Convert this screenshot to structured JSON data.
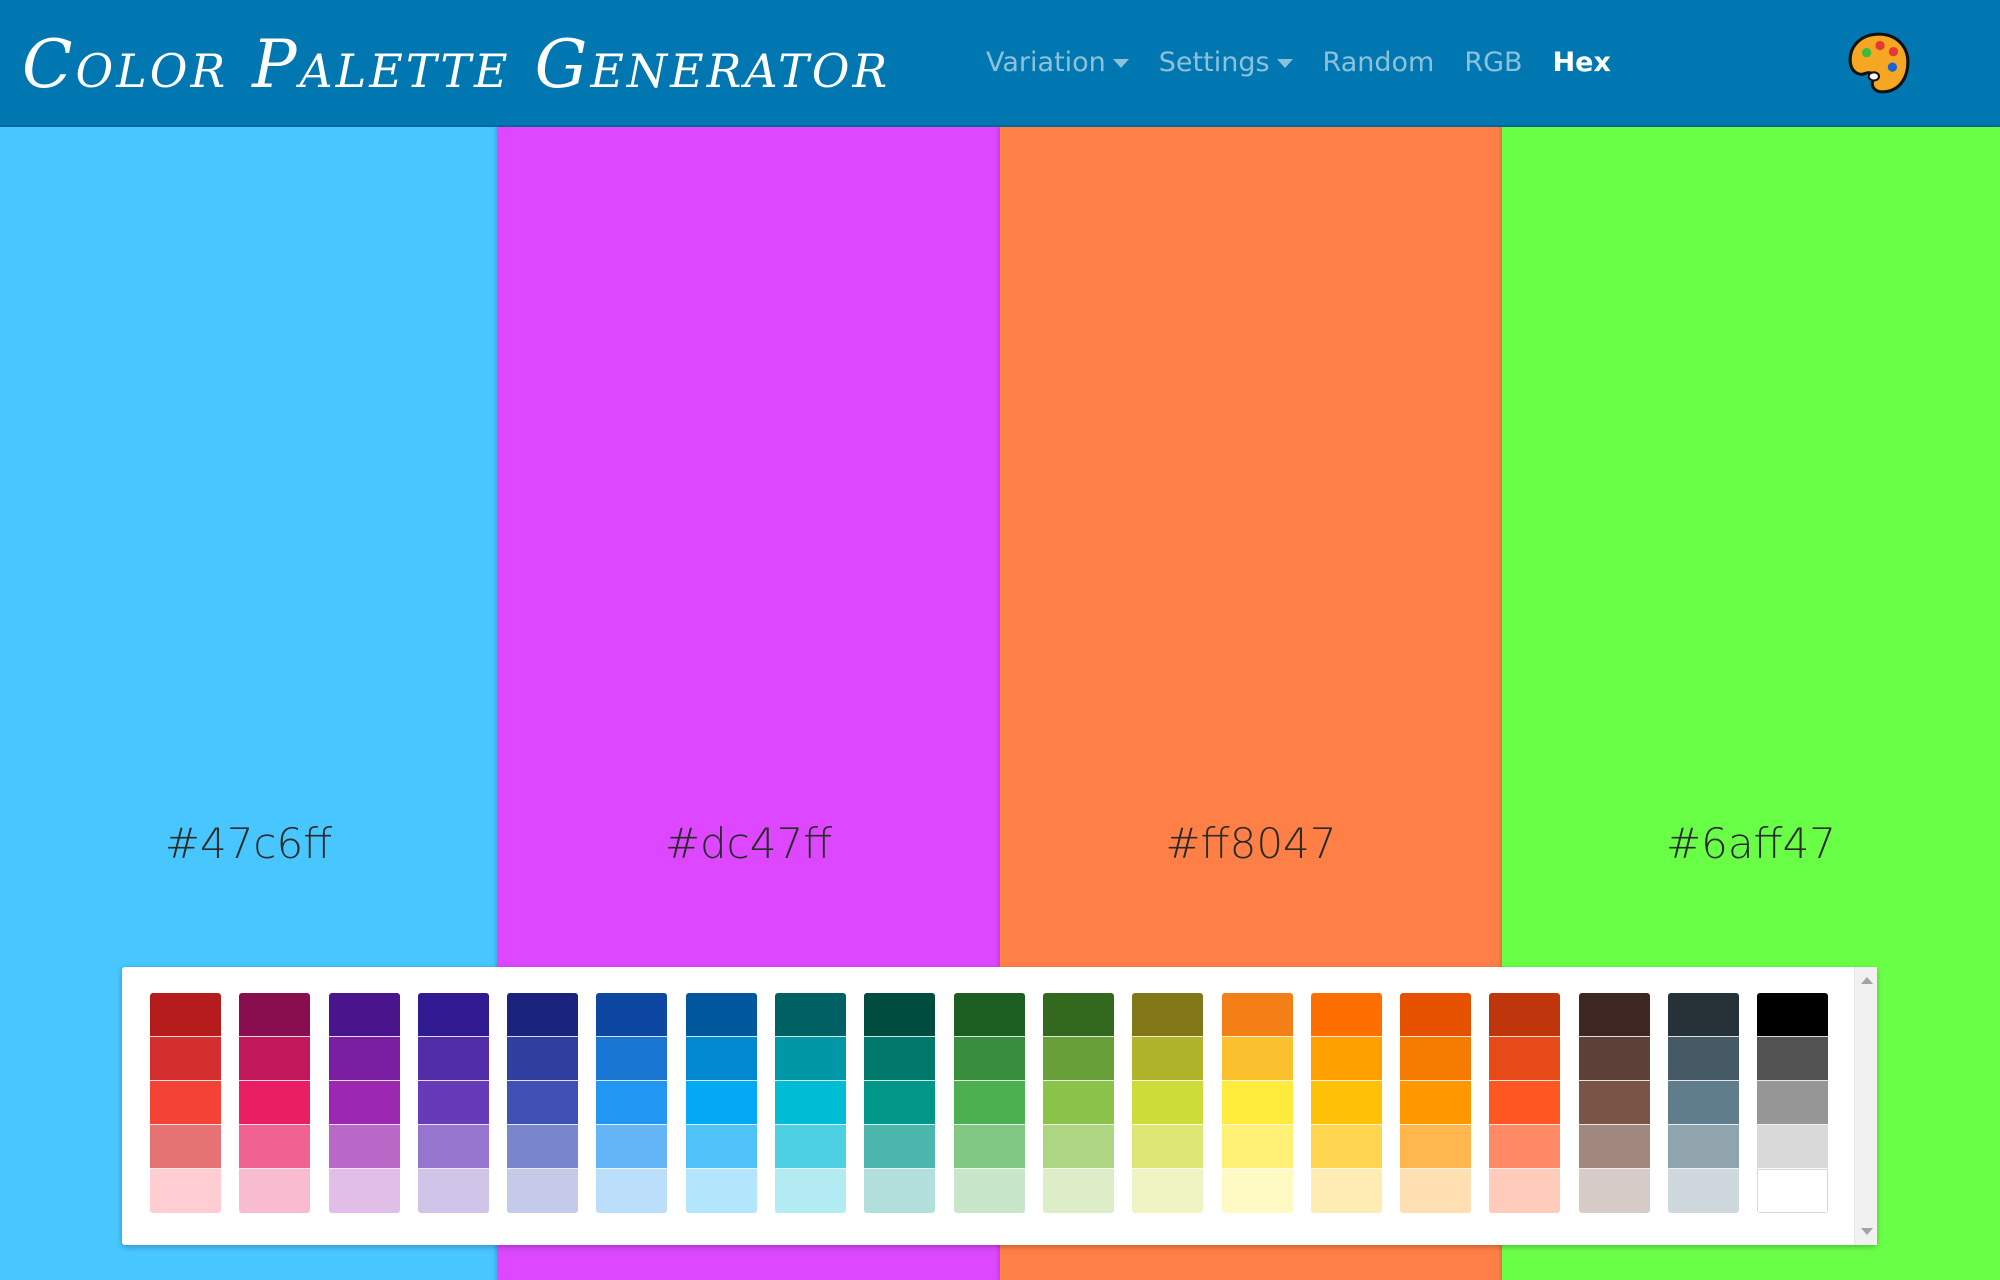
{
  "brand": {
    "title": "Color Palette Generator"
  },
  "nav": {
    "items": [
      {
        "label": "Variation",
        "dropdown": true,
        "active": false,
        "name": "nav-variation"
      },
      {
        "label": "Settings",
        "dropdown": true,
        "active": false,
        "name": "nav-settings"
      },
      {
        "label": "Random",
        "dropdown": false,
        "active": false,
        "name": "nav-random"
      },
      {
        "label": "RGB",
        "dropdown": false,
        "active": false,
        "name": "nav-rgb"
      },
      {
        "label": "Hex",
        "dropdown": false,
        "active": true,
        "name": "nav-hex"
      }
    ],
    "icon": "artist-palette-icon"
  },
  "palette": {
    "colors": [
      {
        "hex": "#47c6ff",
        "label": "#47c6ff"
      },
      {
        "hex": "#dc47ff",
        "label": "#dc47ff"
      },
      {
        "hex": "#ff8047",
        "label": "#ff8047"
      },
      {
        "hex": "#6aff47",
        "label": "#6aff47"
      }
    ]
  },
  "swatch_picker": {
    "groups": [
      [
        "#b71c1c",
        "#d32f2f",
        "#f44336",
        "#e57373",
        "#ffcdd2"
      ],
      [
        "#880e4f",
        "#c2185b",
        "#e91e63",
        "#f06292",
        "#f8bbd0"
      ],
      [
        "#4a148c",
        "#7b1fa2",
        "#9c27b0",
        "#ba68c8",
        "#e1bee7"
      ],
      [
        "#311b92",
        "#512da8",
        "#673ab7",
        "#9575cd",
        "#d1c4e9"
      ],
      [
        "#1a237e",
        "#303f9f",
        "#3f51b5",
        "#7986cb",
        "#c5cae9"
      ],
      [
        "#0d47a1",
        "#1976d2",
        "#2196f3",
        "#64b5f6",
        "#bbdefb"
      ],
      [
        "#01579b",
        "#0288d1",
        "#03a9f4",
        "#4fc3f7",
        "#b3e5fc"
      ],
      [
        "#006064",
        "#0097a7",
        "#00bcd4",
        "#4dd0e1",
        "#b2ebf2"
      ],
      [
        "#004d40",
        "#00796b",
        "#009688",
        "#4db6ac",
        "#b2dfdb"
      ],
      [
        "#1b5e20",
        "#388e3c",
        "#4caf50",
        "#81c784",
        "#c8e6c9"
      ],
      [
        "#33691e",
        "#689f38",
        "#8bc34a",
        "#aed581",
        "#dcedc8"
      ],
      [
        "#827717",
        "#afb42b",
        "#cddc39",
        "#dce775",
        "#f0f4c3"
      ],
      [
        "#f57f17",
        "#fbc02d",
        "#ffeb3b",
        "#fff176",
        "#fff9c4"
      ],
      [
        "#ff6f00",
        "#ffa000",
        "#ffc107",
        "#ffd54f",
        "#ffecb3"
      ],
      [
        "#e65100",
        "#f57c00",
        "#ff9800",
        "#ffb74d",
        "#ffe0b2"
      ],
      [
        "#bf360c",
        "#e64a19",
        "#ff5722",
        "#ff8a65",
        "#ffccbc"
      ],
      [
        "#3e2723",
        "#5d4037",
        "#795548",
        "#a1887f",
        "#d7ccc8"
      ],
      [
        "#263238",
        "#455a64",
        "#607d8b",
        "#90a4ae",
        "#cfd8dc"
      ],
      [
        "#000000",
        "#525252",
        "#969696",
        "#d9d9d9",
        "#ffffff"
      ]
    ]
  }
}
